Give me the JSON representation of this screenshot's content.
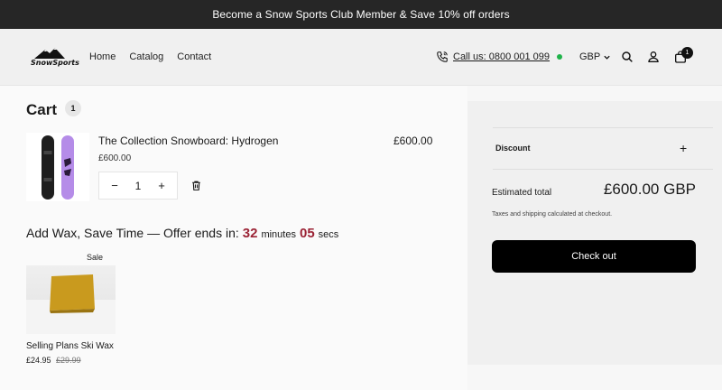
{
  "announcement": "Become a Snow Sports Club Member & Save 10% off orders",
  "brand": {
    "logo_text": "SnowSports"
  },
  "nav": [
    "Home",
    "Catalog",
    "Contact"
  ],
  "header": {
    "call_label": "Call us: 0800 001 099",
    "currency": "GBP",
    "cart_badge": "1",
    "icons": [
      "phone-icon",
      "chevron-down-icon",
      "search-icon",
      "account-icon",
      "bag-icon"
    ]
  },
  "cart": {
    "title": "Cart",
    "count": "1",
    "items": [
      {
        "name": "The Collection Snowboard: Hydrogen",
        "unit_price": "£600.00",
        "total": "£600.00",
        "quantity": "1"
      }
    ]
  },
  "offer": {
    "text": "Add Wax, Save Time — Offer ends in:",
    "minutes": "32",
    "minutes_label": "minutes",
    "seconds": "05",
    "seconds_label": "secs"
  },
  "upsell": {
    "badge": "Sale",
    "name": "Selling Plans Ski Wax",
    "price": "£24.95",
    "compare_price": "£29.99"
  },
  "summary": {
    "discount_label": "Discount",
    "estimated_label": "Estimated total",
    "estimated_value": "£600.00 GBP",
    "tax_note": "Taxes and shipping calculated at checkout.",
    "checkout_label": "Check out"
  },
  "colors": {
    "announcement_bg": "#262626",
    "accent_timer": "#9b2335",
    "status_dot": "#1fb34a",
    "checkout_bg": "#000000"
  }
}
